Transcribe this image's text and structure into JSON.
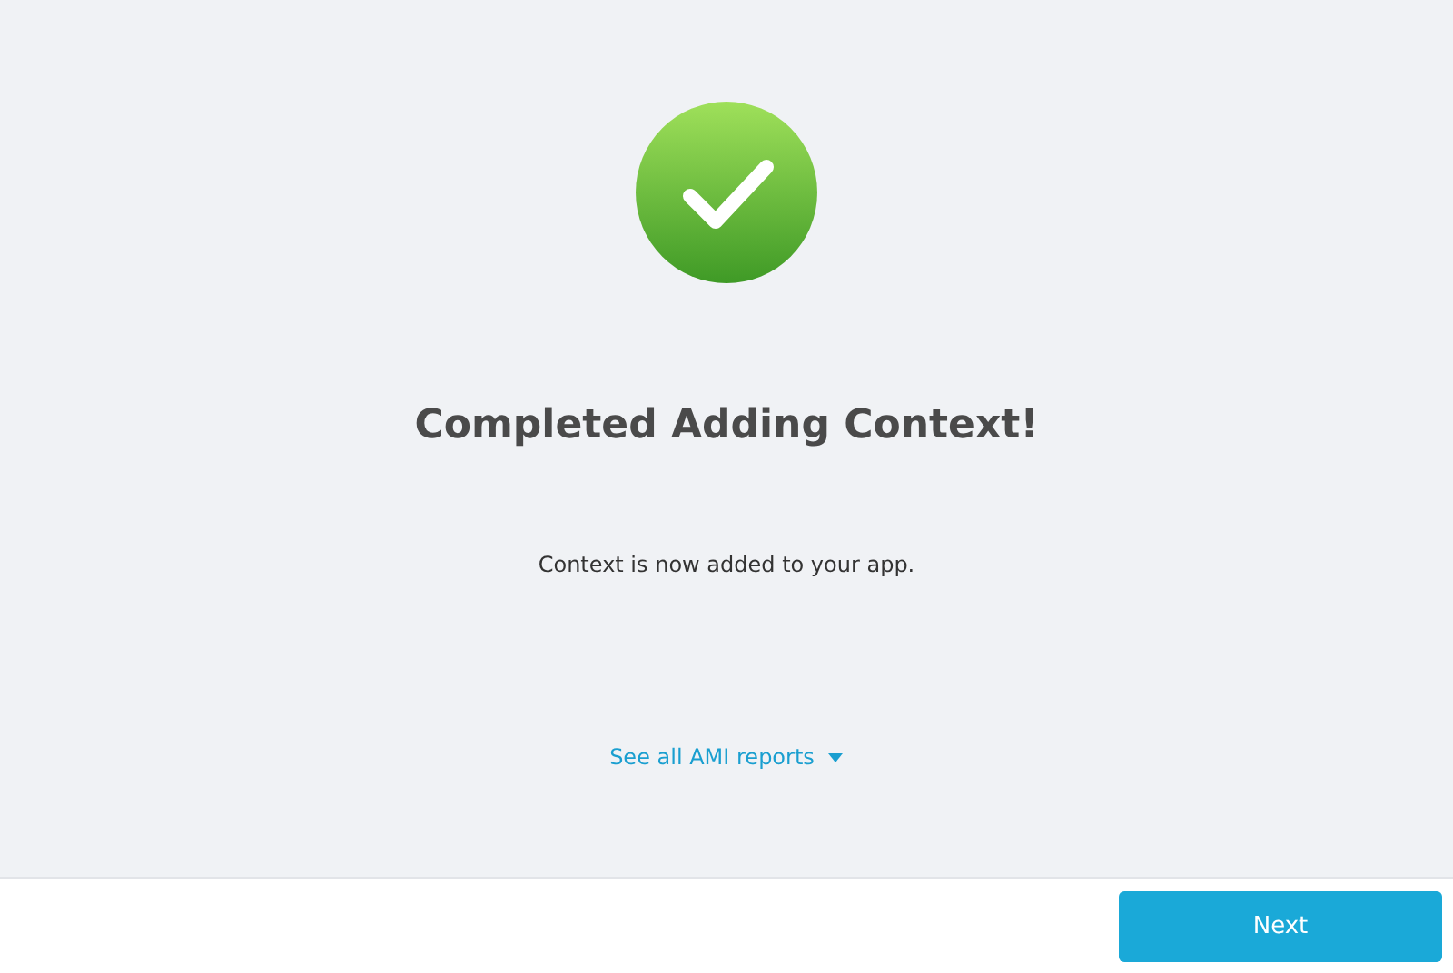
{
  "title": "Completed Adding Context!",
  "message": "Context is now added to your app.",
  "reports_link": {
    "label": "See all AMI reports",
    "expanded": false
  },
  "buttons": [
    {
      "label": "Next",
      "kind": "primary"
    }
  ]
}
